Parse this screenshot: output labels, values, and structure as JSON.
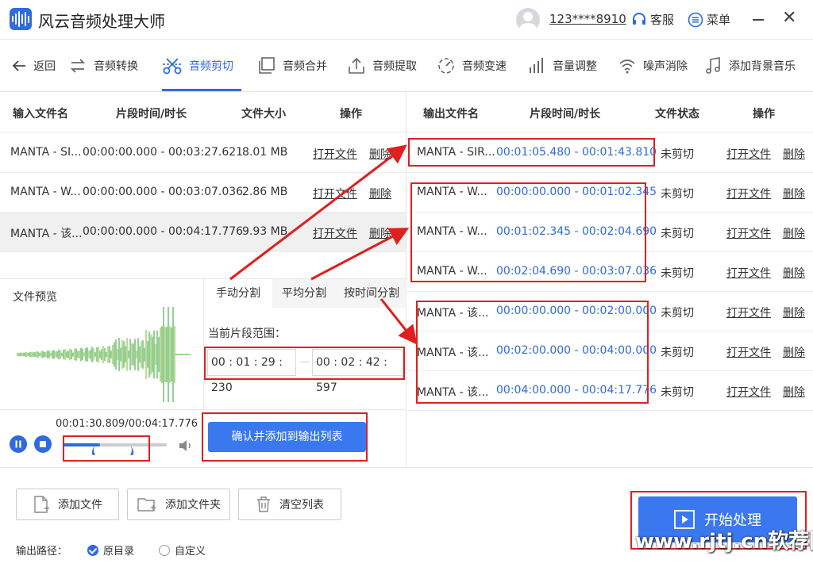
{
  "app": {
    "title": "风云音频处理大师",
    "user_phone": "123****8910",
    "service_label": "客服",
    "menu_label": "菜单"
  },
  "toolbar": {
    "back": "返回",
    "items": [
      {
        "label": "音频转换",
        "icon": "convert-icon"
      },
      {
        "label": "音频剪切",
        "icon": "scissors-icon",
        "active": true
      },
      {
        "label": "音频合并",
        "icon": "merge-icon"
      },
      {
        "label": "音频提取",
        "icon": "extract-icon"
      },
      {
        "label": "音频变速",
        "icon": "speed-icon"
      },
      {
        "label": "音量调整",
        "icon": "volume-bars-icon"
      },
      {
        "label": "噪声消除",
        "icon": "noise-icon"
      },
      {
        "label": "添加背景音乐",
        "icon": "music-note-icon"
      }
    ]
  },
  "input_table": {
    "headers": [
      "输入文件名",
      "片段时间/时长",
      "文件大小",
      "操作"
    ],
    "rows": [
      {
        "name": "MANTA - SI...",
        "range": "00:00:00.000 - 00:03:27.621",
        "size": "8.01 MB",
        "open": "打开文件",
        "del": "删除"
      },
      {
        "name": "MANTA - W...",
        "range": "00:00:00.000 - 00:03:07.036",
        "size": "2.86 MB",
        "open": "打开文件",
        "del": "删除"
      },
      {
        "name": "MANTA - 该...",
        "range": "00:00:00.000 - 00:04:17.776",
        "size": "9.93 MB",
        "open": "打开文件",
        "del": "删除"
      }
    ]
  },
  "output_table": {
    "headers": [
      "输出文件名",
      "片段时间/时长",
      "文件状态",
      "操作"
    ],
    "rows": [
      {
        "name": "MANTA - SIR...",
        "range": "00:01:05.480 - 00:01:43.810",
        "status": "未剪切",
        "open": "打开文件",
        "del": "删除"
      },
      {
        "name": "MANTA - W...",
        "range": "00:00:00.000 - 00:01:02.345",
        "status": "未剪切",
        "open": "打开文件",
        "del": "删除"
      },
      {
        "name": "MANTA - W...",
        "range": "00:01:02.345 - 00:02:04.690",
        "status": "未剪切",
        "open": "打开文件",
        "del": "删除"
      },
      {
        "name": "MANTA - W...",
        "range": "00:02:04.690 - 00:03:07.036",
        "status": "未剪切",
        "open": "打开文件",
        "del": "删除"
      },
      {
        "name": "MANTA - 该...",
        "range": "00:00:00.000 - 00:02:00.000",
        "status": "未剪切",
        "open": "打开文件",
        "del": "删除"
      },
      {
        "name": "MANTA - 该...",
        "range": "00:02:00.000 - 00:04:00.000",
        "status": "未剪切",
        "open": "打开文件",
        "del": "删除"
      },
      {
        "name": "MANTA - 该...",
        "range": "00:04:00.000 - 00:04:17.776",
        "status": "未剪切",
        "open": "打开文件",
        "del": "删除"
      }
    ]
  },
  "preview": {
    "label": "文件预览",
    "time": "00:01:30.809/00:04:17.776",
    "progress": 0.35
  },
  "split": {
    "tabs": [
      "手动分割",
      "平均分割",
      "按时间分割"
    ],
    "range_label": "当前片段范围：",
    "start": "00 : 01 : 29 : 230",
    "end": "00 : 02 : 42 : 597",
    "confirm": "确认并添加到输出列表"
  },
  "bottom": {
    "add_file": "添加文件",
    "add_folder": "添加文件夹",
    "clear": "清空列表",
    "output_path_label": "输出路径：",
    "opt_original": "原目录",
    "opt_custom": "自定义",
    "start": "开始处理"
  },
  "watermark": "www.rjtj.cn软荐网",
  "colors": {
    "accent": "#2f6ae0",
    "annotation": "#e01f1f"
  }
}
